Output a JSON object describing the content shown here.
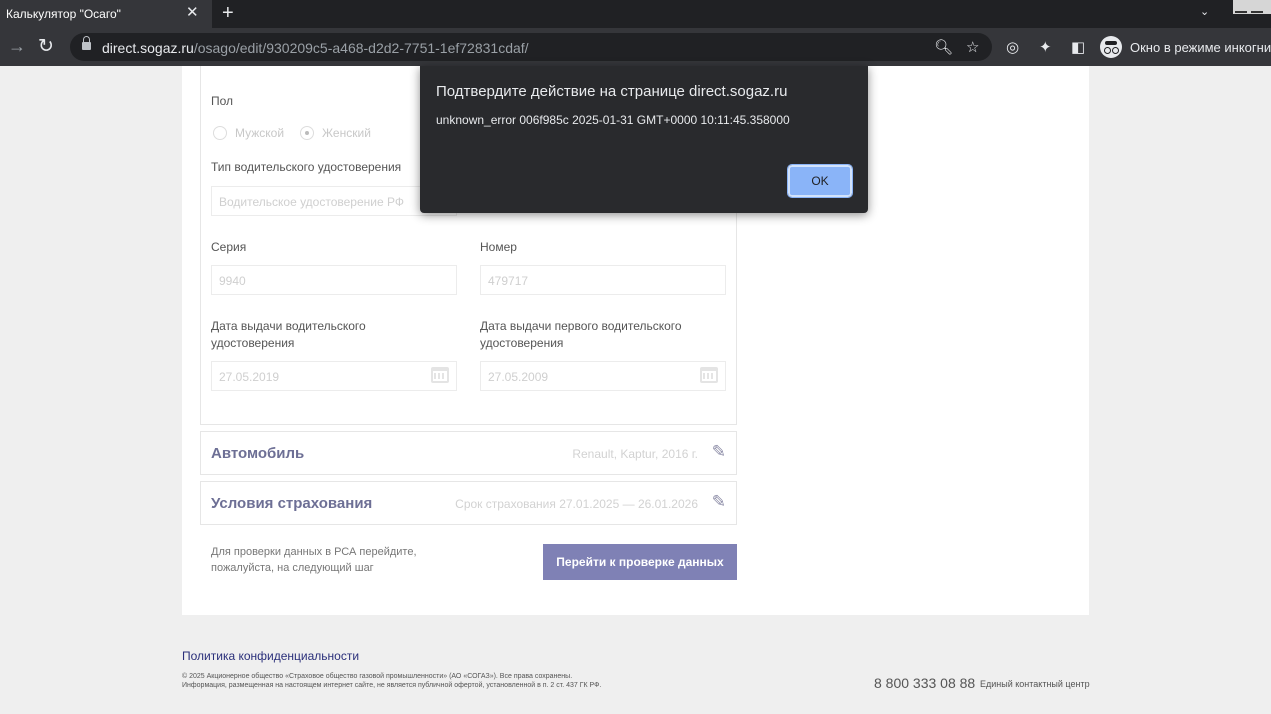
{
  "browser": {
    "tab_title": "Калькулятор \"Осаго\"",
    "tab_close": "✕",
    "new_tab": "+",
    "url_host": "direct.sogaz.ru",
    "url_path": "/osago/edit/930209c5-a468-d2d2-7751-1ef72831cdaf/",
    "incognito_label": "Окно в режиме инкогнито"
  },
  "form": {
    "gender_label": "Пол",
    "gender_options": [
      "Мужской",
      "Женский"
    ],
    "gender_selected": "Женский",
    "license_type_label": "Тип водительского удостоверения",
    "license_type_value": "Водительское удостоверение РФ",
    "series_label": "Серия",
    "series_value": "9940",
    "number_label": "Номер",
    "number_value": "479717",
    "issue_date_label": "Дата выдачи водительского удостоверения",
    "issue_date_value": "27.05.2019",
    "first_issue_label": "Дата выдачи первого водительского удостоверения",
    "first_issue_value": "27.05.2009"
  },
  "sections": {
    "car_title": "Автомобиль",
    "car_summary": "Renault, Kaptur, 2016 г.",
    "terms_title": "Условия страхования",
    "terms_summary": "Срок страхования 27.01.2025 — 26.01.2026"
  },
  "actions": {
    "hint": "Для проверки данных в РСА перейдите, пожалуйста, на следующий шаг",
    "next_button": "Перейти к проверке данных"
  },
  "footer": {
    "privacy_link": "Политика конфиденциальности",
    "legal_line1": "© 2025 Акционерное общество «Страховое общество газовой промышленности» (АО «СОГАЗ»). Все права сохранены.",
    "legal_line2": "Информация, размещенная на настоящем интернет сайте, не является публичной офертой, установленной в п. 2 ст. 437 ГК РФ.",
    "phone": "8 800 333 08 88",
    "phone_label": "Единый контактный центр"
  },
  "dialog": {
    "title": "Подтвердите действие на странице direct.sogaz.ru",
    "message": "unknown_error 006f985c 2025-01-31 GMT+0000 10:11:45.358000",
    "ok_label": "OK"
  },
  "colors": {
    "accent_button": "#7f81b5",
    "section_title": "#6d6f95",
    "dialog_bg": "#292a2d",
    "dialog_ok": "#8ab4f8"
  }
}
